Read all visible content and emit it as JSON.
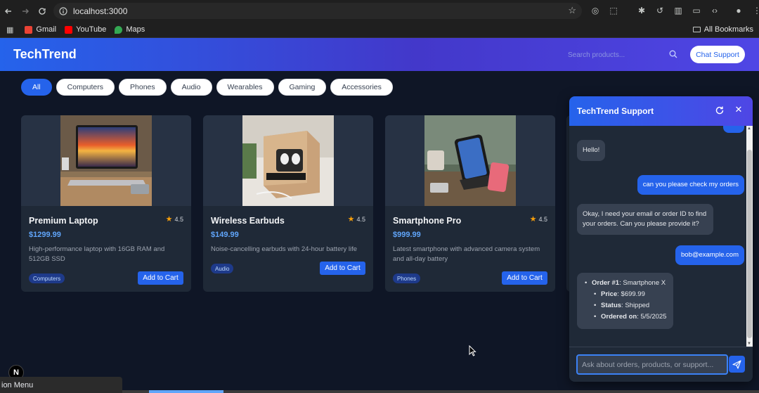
{
  "browser": {
    "url": "localhost:3000",
    "bookmarks": [
      {
        "label": "Gmail",
        "color": "#ea4335"
      },
      {
        "label": "YouTube",
        "color": "#ff0000"
      },
      {
        "label": "Maps",
        "color": "#34a853"
      }
    ],
    "all_bookmarks": "All Bookmarks"
  },
  "header": {
    "brand": "TechTrend",
    "search_placeholder": "Search products...",
    "support_button": "Chat Support"
  },
  "categories": [
    "All",
    "Computers",
    "Phones",
    "Audio",
    "Wearables",
    "Gaming",
    "Accessories"
  ],
  "active_category": "All",
  "products": [
    {
      "name": "Premium Laptop",
      "rating": "4.5",
      "price": "$1299.99",
      "description": "High-performance laptop with 16GB RAM and 512GB SSD",
      "category": "Computers",
      "button": "Add to Cart"
    },
    {
      "name": "Wireless Earbuds",
      "rating": "4.5",
      "price": "$149.99",
      "description": "Noise-cancelling earbuds with 24-hour battery life",
      "category": "Audio",
      "button": "Add to Cart"
    },
    {
      "name": "Smartphone Pro",
      "rating": "4.5",
      "price": "$999.99",
      "description": "Latest smartphone with advanced camera system and all-day battery",
      "category": "Phones",
      "button": "Add to Cart"
    }
  ],
  "chat": {
    "title": "TechTrend Support",
    "messages": [
      {
        "from": "bot",
        "text": "Hello!"
      },
      {
        "from": "user",
        "text": "can you please check my orders"
      },
      {
        "from": "bot",
        "text": "Okay, I need your email or order ID to find your orders. Can you please provide it?"
      },
      {
        "from": "user",
        "text": "bob@example.com"
      }
    ],
    "order": {
      "order_label": "Order #1",
      "order_value": "Smartphone X",
      "price_label": "Price",
      "price_value": "$699.99",
      "status_label": "Status",
      "status_value": "Shipped",
      "date_label": "Ordered on",
      "date_value": "5/5/2025"
    },
    "input_placeholder": "Ask about orders, products, or support..."
  },
  "overlay": {
    "next_badge": "N",
    "menu_tooltip": "ion Menu"
  },
  "colors": {
    "accent": "#2563eb",
    "background": "#0f1626",
    "card": "#1f2937",
    "price": "#60a5fa",
    "star": "#f59e0b"
  }
}
